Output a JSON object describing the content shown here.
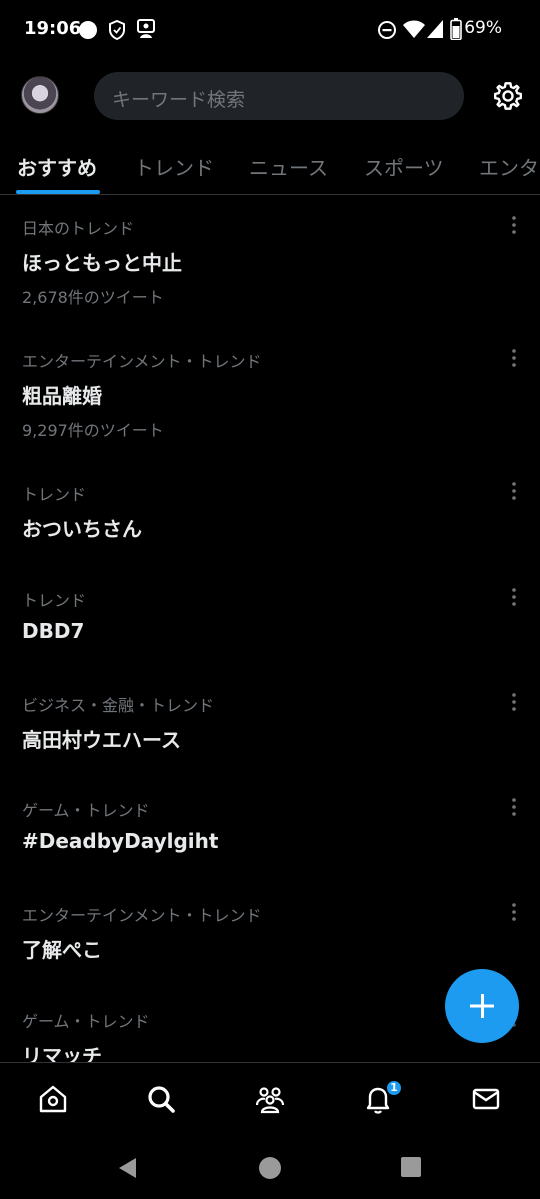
{
  "status_bar": {
    "time": "19:06",
    "battery_percent": "69%"
  },
  "header": {
    "search_placeholder": "キーワード検索"
  },
  "tabs": [
    {
      "label": "おすすめ",
      "active": true
    },
    {
      "label": "トレンド",
      "active": false
    },
    {
      "label": "ニュース",
      "active": false
    },
    {
      "label": "スポーツ",
      "active": false
    },
    {
      "label": "エンタ",
      "active": false
    }
  ],
  "trends": [
    {
      "category": "日本のトレンド",
      "title": "ほっともっと中止",
      "count": "2,678件のツイート"
    },
    {
      "category": "エンターテインメント・トレンド",
      "title": "粗品離婚",
      "count": "9,297件のツイート"
    },
    {
      "category": "トレンド",
      "title": "おついちさん",
      "count": ""
    },
    {
      "category": "トレンド",
      "title": "DBD7",
      "count": ""
    },
    {
      "category": "ビジネス・金融・トレンド",
      "title": "高田村ウエハース",
      "count": ""
    },
    {
      "category": "ゲーム・トレンド",
      "title": "#DeadbyDaylgiht",
      "count": ""
    },
    {
      "category": "エンターテインメント・トレンド",
      "title": "了解ぺこ",
      "count": ""
    },
    {
      "category": "ゲーム・トレンド",
      "title": "リマッチ",
      "count": ""
    }
  ],
  "bottom_nav": {
    "items": [
      "home-icon",
      "search-icon",
      "communities-icon",
      "notifications-icon",
      "messages-icon"
    ],
    "notification_badge": "1"
  },
  "colors": {
    "accent": "#1d9bf0",
    "background": "#000000",
    "text_primary": "#e7e9ea",
    "text_secondary": "#71767b"
  }
}
